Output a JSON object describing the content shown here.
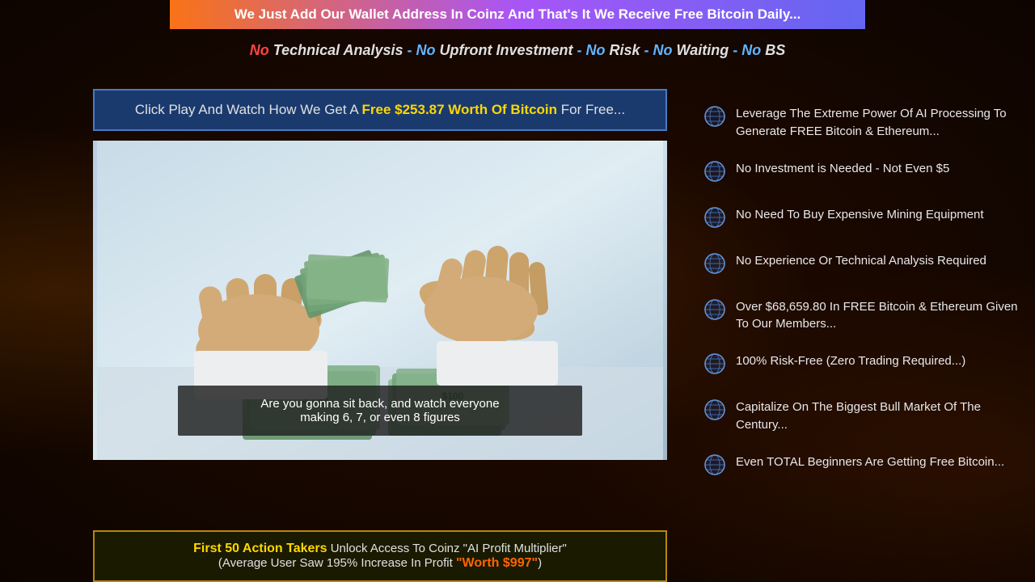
{
  "banner": {
    "text": "We Just Add Our Wallet Address In Coinz And That's It We Receive Free Bitcoin Daily..."
  },
  "tagline": {
    "no1": "No",
    "part1": " Technical Analysis ",
    "dash1": "- ",
    "no2": "No",
    "part2": " Upfront Investment ",
    "dash2": "- ",
    "no3": "No",
    "part3": " Risk ",
    "dash3": "- ",
    "no4": "No",
    "part4": " Waiting ",
    "dash4": "- ",
    "no5": "No",
    "part5": " BS"
  },
  "cta": {
    "label_start": "Click Play And Watch How We Get A ",
    "label_amount": "Free $253.87 Worth Of Bitcoin",
    "label_end": " For Free..."
  },
  "subtitle": {
    "line1": "Are you gonna sit back, and watch everyone",
    "line2": "making 6, 7, or even 8 figures"
  },
  "promo": {
    "first50": "First 50 Action Takers",
    "text1": " Unlock Access To Coinz \"AI Profit Multiplier\"",
    "text2": "(Average User Saw 195% Increase In Profit ",
    "worth": "\"Worth $997\"",
    "text3": ")"
  },
  "features": [
    {
      "id": "feature-ai",
      "text": "Leverage The Extreme Power Of AI Processing To Generate FREE Bitcoin & Ethereum..."
    },
    {
      "id": "feature-no-investment",
      "text": "No Investment is Needed - Not Even $5"
    },
    {
      "id": "feature-no-mining",
      "text": "No Need To Buy Expensive Mining Equipment"
    },
    {
      "id": "feature-no-experience",
      "text": "No Experience Or Technical Analysis Required"
    },
    {
      "id": "feature-over-68k",
      "text": "Over $68,659.80 In FREE Bitcoin & Ethereum Given To Our Members..."
    },
    {
      "id": "feature-risk-free",
      "text": "100% Risk-Free (Zero Trading Required...)"
    },
    {
      "id": "feature-bull-market",
      "text": "Capitalize On The Biggest Bull Market Of The Century..."
    },
    {
      "id": "feature-beginners",
      "text": "Even TOTAL Beginners Are Getting Free Bitcoin..."
    }
  ],
  "colors": {
    "accent_gold": "#ffd700",
    "accent_orange": "#ff6600",
    "accent_blue": "#60b4ff",
    "accent_red": "#ff4444",
    "bg_dark": "#1a0800",
    "banner_gradient_start": "#f97316",
    "banner_gradient_end": "#6366f1"
  }
}
